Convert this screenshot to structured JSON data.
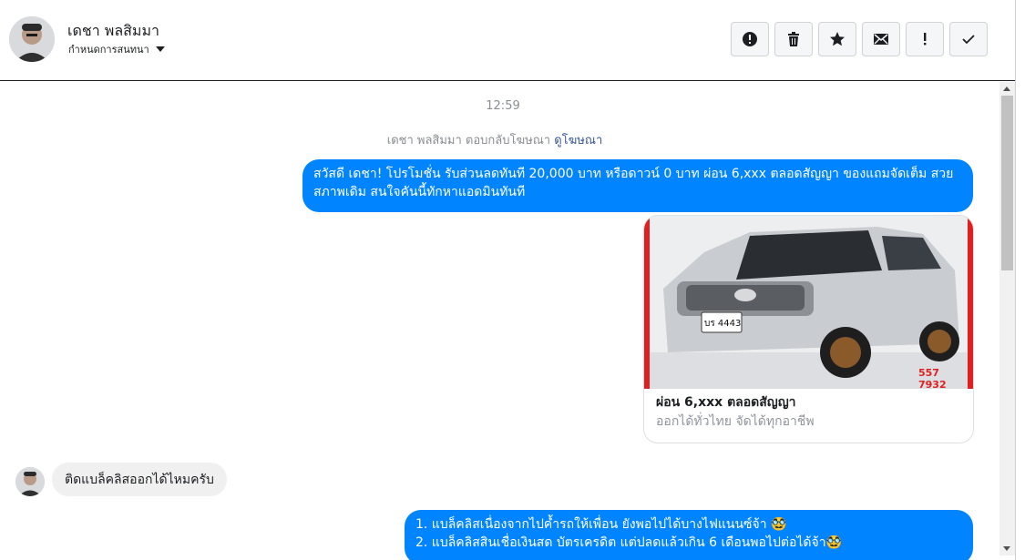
{
  "header": {
    "name": "เดชา พลสิมมา",
    "sub_label": "กำหนดการสนทนา",
    "toolbar": [
      {
        "icon": "alert-circle-icon"
      },
      {
        "icon": "trash-icon"
      },
      {
        "icon": "star-icon"
      },
      {
        "icon": "envelope-icon"
      },
      {
        "icon": "exclamation-icon"
      },
      {
        "icon": "check-icon"
      }
    ]
  },
  "conversation": {
    "timestamp": "12:59",
    "ad_reply_text": "เดชา พลสิมมา ตอบกลับโฆษณา",
    "ad_link": "ดูโฆษณา",
    "messages": {
      "out_1": "สวัสดี เดชา! โปรโมชั่น รับส่วนลดทันที 20,000 บาท หรือดาวน์ 0 บาท ผ่อน 6,xxx ตลอดสัญญา ของแถมจัดเต็ม สวยสภาพเดิม สนใจคันนี้ทักหาแอดมินทันที",
      "card_title": "ผ่อน 6,xxx ตลอดสัญญา",
      "card_subtitle": "ออกได้ทั่วไทย จัดได้ทุกอาชีพ",
      "plate": "บร 4443",
      "phone": "557 7932",
      "in_1": "ติดแบล็คลิสออกได้ไหมครับ",
      "out_2_line1": "1. แบล็คลิสเนื่องจากไปค้ำรถให้เพื่อน ยังพอไปได้บางไฟแนนซ์จ้า 🥸",
      "out_2_line2": "2. แบล็คลิสสินเชื่อเงินสด บัตรเครดิต แต่ปลดแล้วเกิน 6 เดือนพอไปต่อได้จ้า🥸"
    }
  },
  "colors": {
    "bubble_out": "#0084ff",
    "bubble_in": "#f1f0f0",
    "card_border_accent": "#e02020"
  }
}
